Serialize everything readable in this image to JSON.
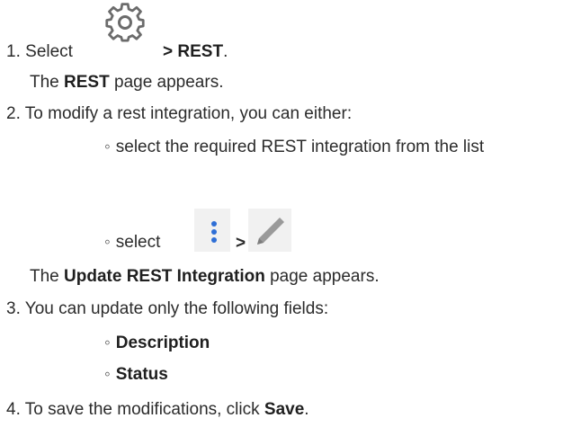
{
  "colors": {
    "text": "#2b2b2b",
    "gear_icon": "#6b6b6b",
    "kebab_dots": "#2f6fd6",
    "pencil": "#9a9a9a",
    "icon_background": "#f1f1f1"
  },
  "steps": [
    {
      "number": "1.",
      "prefix": "Select",
      "icon": "gear-icon",
      "suffix": "> REST",
      "end": ".",
      "result_pre": "The ",
      "result_bold": "REST",
      "result_post": " page appears."
    },
    {
      "number": "2.",
      "text": "To modify a rest integration, you can either:",
      "options": [
        {
          "text": "select the required REST integration from the list"
        },
        {
          "prefix": "select",
          "icons": [
            "kebab-menu-icon",
            "pencil-icon"
          ],
          "separator": ">"
        }
      ],
      "result_pre": "The ",
      "result_bold": "Update REST Integration",
      "result_post": " page appears."
    },
    {
      "number": "3.",
      "text": "You can update only the following fields:",
      "fields": [
        "Description",
        "Status"
      ]
    },
    {
      "number": "4.",
      "text_pre": "To save the modifications, click ",
      "text_bold": "Save",
      "text_post": "."
    }
  ]
}
